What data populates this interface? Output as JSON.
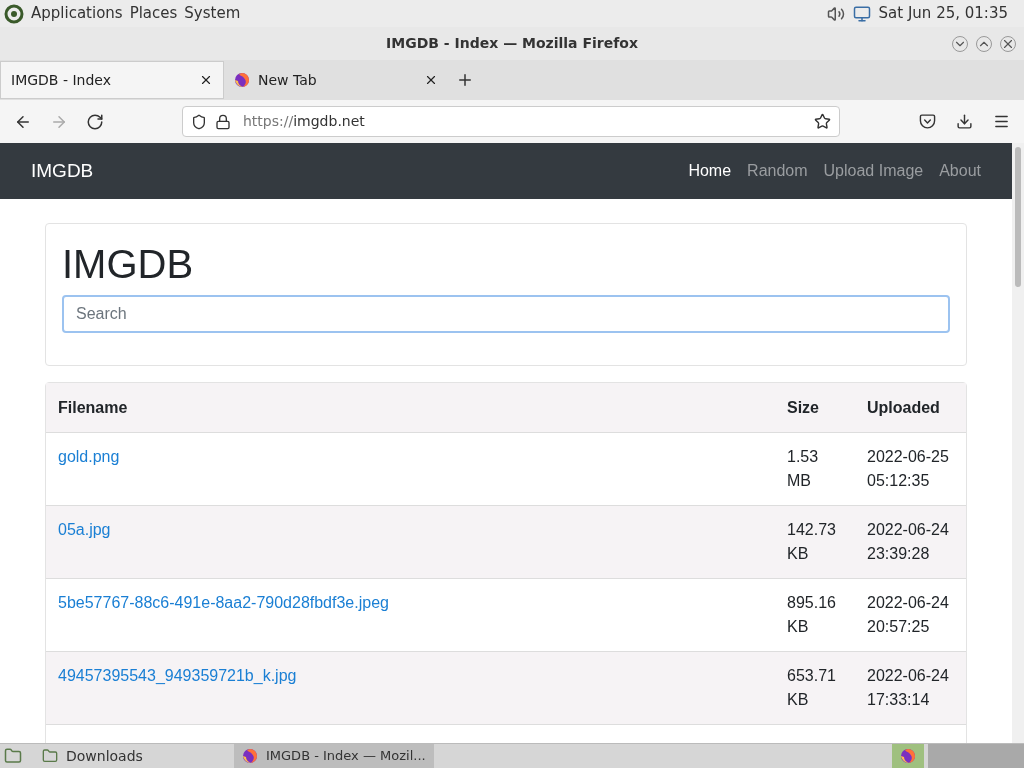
{
  "top_panel": {
    "menus": [
      "Applications",
      "Places",
      "System"
    ],
    "clock": "Sat Jun 25, 01:35"
  },
  "window": {
    "title": "IMGDB - Index — Mozilla Firefox"
  },
  "tabs": [
    {
      "label": "IMGDB - Index",
      "selected": true,
      "kind": "plain"
    },
    {
      "label": "New Tab",
      "selected": false,
      "kind": "firefox"
    }
  ],
  "address_bar": {
    "scheme": "https://",
    "host": "imgdb.net"
  },
  "navbar": {
    "brand": "IMGDB",
    "links": [
      {
        "label": "Home",
        "selected": true
      },
      {
        "label": "Random",
        "selected": false
      },
      {
        "label": "Upload Image",
        "selected": false
      },
      {
        "label": "About",
        "selected": false
      }
    ]
  },
  "header": {
    "title": "IMGDB",
    "search": {
      "placeholder": "Search"
    }
  },
  "table": {
    "columns": [
      "Filename",
      "Size",
      "Uploaded"
    ],
    "rows": [
      {
        "filename": "gold.png",
        "size": "1.53 MB",
        "uploaded": "2022-06-25 05:12:35"
      },
      {
        "filename": "05a.jpg",
        "size": "142.73 KB",
        "uploaded": "2022-06-24 23:39:28"
      },
      {
        "filename": "5be57767-88c6-491e-8aa2-790d28fbdf3e.jpeg",
        "size": "895.16 KB",
        "uploaded": "2022-06-24 20:57:25"
      },
      {
        "filename": "49457395543_949359721b_k.jpg",
        "size": "653.71 KB",
        "uploaded": "2022-06-24 17:33:14"
      }
    ]
  },
  "taskbar": {
    "items": [
      {
        "label": "Downloads",
        "kind": "folder",
        "selected": false
      },
      {
        "label": "IMGDB - Index — Mozil...",
        "kind": "firefox",
        "selected": true
      }
    ]
  }
}
